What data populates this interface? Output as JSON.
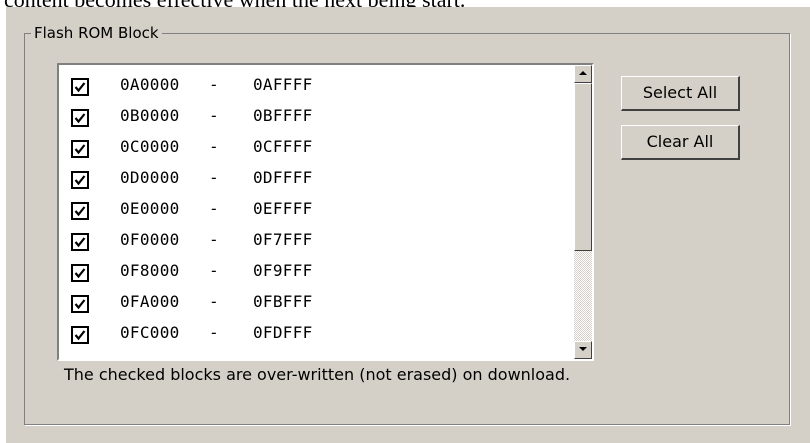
{
  "top_text": "content becomes effective when the next being start.",
  "group": {
    "title": "Flash ROM Block"
  },
  "blocks": [
    {
      "start": "0A0000",
      "sep": "-",
      "end": "0AFFFF",
      "checked": true
    },
    {
      "start": "0B0000",
      "sep": "-",
      "end": "0BFFFF",
      "checked": true
    },
    {
      "start": "0C0000",
      "sep": "-",
      "end": "0CFFFF",
      "checked": true
    },
    {
      "start": "0D0000",
      "sep": "-",
      "end": "0DFFFF",
      "checked": true
    },
    {
      "start": "0E0000",
      "sep": "-",
      "end": "0EFFFF",
      "checked": true
    },
    {
      "start": "0F0000",
      "sep": "-",
      "end": "0F7FFF",
      "checked": true
    },
    {
      "start": "0F8000",
      "sep": "-",
      "end": "0F9FFF",
      "checked": true
    },
    {
      "start": "0FA000",
      "sep": "-",
      "end": "0FBFFF",
      "checked": true
    },
    {
      "start": "0FC000",
      "sep": "-",
      "end": "0FDFFF",
      "checked": true
    }
  ],
  "buttons": {
    "select_all": "Select All",
    "clear_all": "Clear All"
  },
  "note": "The checked blocks are over-written (not erased) on download.",
  "colors": {
    "dialog_bg": "#d4d0c8",
    "list_bg": "#ffffff",
    "text": "#000000"
  }
}
